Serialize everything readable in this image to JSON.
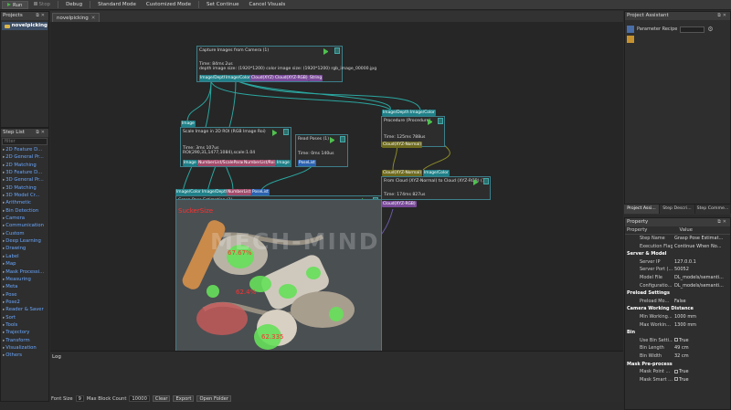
{
  "toolbar": {
    "run": "Run",
    "stop": "Stop",
    "debug": "Debug",
    "standard_mode": "Standard Mode",
    "customized_mode": "Customized Mode",
    "set_continue": "Set Continue",
    "cancel_visuals": "Cancel Visuals"
  },
  "projects": {
    "title": "Projects",
    "item": "novelpicking"
  },
  "steplist": {
    "title": "Step List",
    "filter_placeholder": "filter",
    "items": [
      "2D Feature D...",
      "2D General Pr...",
      "2D Matching",
      "3D Feature D...",
      "3D General Pr...",
      "3D Matching",
      "3D Model Cr...",
      "Arithmetic",
      "Bin Detection",
      "Camera",
      "Communication",
      "Custom",
      "Deep Learning",
      "Drawing",
      "Label",
      "Map",
      "Mask Processi...",
      "Measuring",
      "Meta",
      "Pose",
      "Pose2",
      "Reader & Saver",
      "Sort",
      "Tools",
      "Trajectory",
      "Transform",
      "Visualization",
      "Others"
    ]
  },
  "canvas": {
    "tab": "novelpicking",
    "nodes": {
      "capture": {
        "title": "Capture Images from Camera (1)",
        "time": "Time: 84ms 2us",
        "info": "depth image size: (1920*1200) color image size: (1920*1200) rgb_image_00000.jpg",
        "ports": [
          "Image/Depth",
          "Image/Color",
          "Cloud(XYZ)",
          "Cloud(XYZ-RGB)",
          "String"
        ]
      },
      "scale": {
        "title": "Scale Image in 2D ROI (RGB Image Roi)",
        "time": "Time: 3ms 107us",
        "info": "ROI(290,31,1477,1084),scale:1.04",
        "in_port": "Image",
        "ports": [
          "Image",
          "NumberList/ScaleParam",
          "NumberList/Roi",
          "Image"
        ]
      },
      "readposes": {
        "title": "Read Poses (1)",
        "time": "Time: 0ms 140us",
        "port": "PoseList"
      },
      "procedure": {
        "title": "Procedure (Procedure)",
        "time": "Time: 125ms 788us",
        "in_ports": [
          "Image/Depth",
          "Image/Color"
        ],
        "port": "Cloud(XYZ-Normal)"
      },
      "fromcloud": {
        "title": "From Cloud (XYZ-Normal) to Cloud (XYZ-RGB) (1)",
        "time": "Time: 174ms 827us",
        "in_ports": [
          "Cloud(XYZ-Normal)",
          "Image/Color"
        ],
        "port": "Cloud(XYZ-RGB)"
      },
      "grasp": {
        "title": "Grasp Pose Estimation (1)",
        "in_ports": [
          "Image/Color",
          "Image/Depth",
          "NumberList",
          "PoseList"
        ],
        "overlay_text": "SuckerSize",
        "labels": [
          "67.67%",
          "62.4%",
          "62.335"
        ]
      }
    },
    "watermark": "MECH-MIND"
  },
  "log": {
    "title": "Log",
    "font_size_label": "Font Size",
    "font_size": "9",
    "max_block_label": "Max Block Count",
    "max_block": "10000",
    "clear": "Clear",
    "export": "Export",
    "open_folder": "Open Folder"
  },
  "assistant": {
    "title": "Project Assistant",
    "recipe_label": "Parameter Recipe",
    "tabs": [
      "Project Assi...",
      "Step Descri...",
      "Step Comme..."
    ]
  },
  "property": {
    "title": "Property",
    "col_property": "Property",
    "col_value": "Value",
    "rows": [
      {
        "k": "Step Name",
        "v": "Grasp Pose Estimat...",
        "sec": false
      },
      {
        "k": "Execution Flags",
        "v": "Continue When No...",
        "sec": false
      },
      {
        "k": "Server & Model",
        "v": "",
        "sec": true
      },
      {
        "k": "Server IP",
        "v": "127.0.0.1",
        "sec": false
      },
      {
        "k": "Server Port (...",
        "v": "50052",
        "sec": false
      },
      {
        "k": "Model File",
        "v": "DL_models/semanti...",
        "sec": false
      },
      {
        "k": "Configuratio...",
        "v": "DL_models/semanti...",
        "sec": false
      },
      {
        "k": "Preload Settings",
        "v": "",
        "sec": true
      },
      {
        "k": "Preload Mo...",
        "v": "False",
        "sec": false
      },
      {
        "k": "Camera Working Distance",
        "v": "",
        "sec": true
      },
      {
        "k": "Min Working...",
        "v": "1000 mm",
        "sec": false
      },
      {
        "k": "Max Workin...",
        "v": "1300 mm",
        "sec": false
      },
      {
        "k": "Bin",
        "v": "",
        "sec": true
      },
      {
        "k": "Use Bin Setti...",
        "v": "True",
        "sec": false
      },
      {
        "k": "Bin Length",
        "v": "49 cm",
        "sec": false
      },
      {
        "k": "Bin Width",
        "v": "32 cm",
        "sec": false
      },
      {
        "k": "Mask Pre-process",
        "v": "",
        "sec": true
      },
      {
        "k": "Mask Point ...",
        "v": "True",
        "sec": false
      },
      {
        "k": "Mask Smart ...",
        "v": "True",
        "sec": false
      }
    ]
  },
  "colors": {
    "accent": "#3d7f8a",
    "link": "#6aa8ff",
    "run": "#49b24a"
  }
}
